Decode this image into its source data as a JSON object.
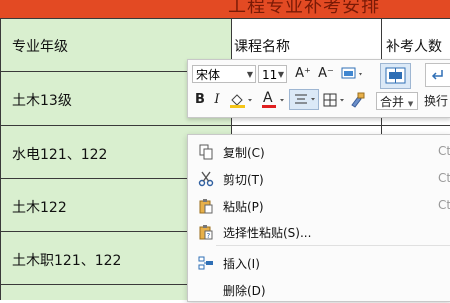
{
  "sheet": {
    "title_partial": "工程专业补考安排",
    "headers": [
      "专业年级",
      "课程名称",
      "补考人数"
    ],
    "rows": [
      "土木13级",
      "水电121、122",
      "土木122",
      "土木职121、122"
    ]
  },
  "mini_toolbar": {
    "font_name": "宋体",
    "font_size": "11",
    "grow_font": "A⁺",
    "shrink_font": "A⁻",
    "bold": "B",
    "italic": "I",
    "font_color": "A",
    "merge_label": "合并",
    "wrap_label": "换行",
    "colors": {
      "fill": "#f5c518",
      "font": "#e02020",
      "accent": "#2f6fb5"
    }
  },
  "context_menu": {
    "items": [
      {
        "label": "复制(C)",
        "shortcut": "Ct",
        "icon": "copy-icon"
      },
      {
        "label": "剪切(T)",
        "shortcut": "Ctr",
        "icon": "scissors-icon"
      },
      {
        "label": "粘贴(P)",
        "shortcut": "Ctr",
        "icon": "paste-icon"
      },
      {
        "label": "选择性粘贴(S)...",
        "shortcut": "",
        "icon": "paste-special-icon"
      },
      {
        "label": "插入(I)",
        "shortcut": "",
        "icon": "insert-icon"
      },
      {
        "label": "删除(D)",
        "shortcut": "",
        "icon": ""
      }
    ]
  },
  "colors": {
    "title_band": "#e34a23",
    "column_a": "#d9efcf",
    "grid": "#3a3a3a"
  }
}
